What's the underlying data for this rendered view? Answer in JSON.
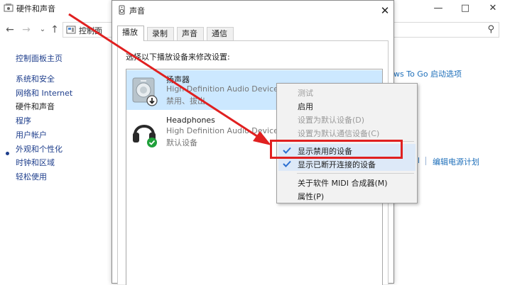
{
  "control_panel": {
    "title": "硬件和声音",
    "address_text": "控制面",
    "sidebar": [
      {
        "label": "控制面板主页",
        "active": false
      },
      {
        "label": "系统和安全",
        "active": false
      },
      {
        "label": "网络和 Internet",
        "active": false
      },
      {
        "label": "硬件和声音",
        "active": true
      },
      {
        "label": "程序",
        "active": false
      },
      {
        "label": "用户帐户",
        "active": false
      },
      {
        "label": "外观和个性化",
        "active": false
      },
      {
        "label": "时钟和区域",
        "active": false
      },
      {
        "label": "轻松使用",
        "active": false
      }
    ],
    "links": {
      "windows_to_go": "ws To Go 启动选项",
      "edit_power": "编辑电源计划",
      "frag": "l"
    }
  },
  "sound_dialog": {
    "title": "声音",
    "tabs": [
      {
        "label": "播放",
        "selected": true
      },
      {
        "label": "录制",
        "selected": false
      },
      {
        "label": "声音",
        "selected": false
      },
      {
        "label": "通信",
        "selected": false
      }
    ],
    "instruction": "选择以下播放设备来修改设置:",
    "devices": [
      {
        "name": "扬声器",
        "description": "High Definition Audio Device",
        "status": "禁用、拔出",
        "selected": true,
        "badge": "down-arrow-badge"
      },
      {
        "name": "Headphones",
        "description": "High Definition Audio Device",
        "status": "默认设备",
        "selected": false,
        "badge": "green-check-badge"
      }
    ]
  },
  "context_menu": {
    "items": [
      {
        "label": "测试",
        "disabled": true,
        "checked": false
      },
      {
        "label": "启用",
        "disabled": false,
        "checked": false
      },
      {
        "label": "设置为默认设备(D)",
        "disabled": true,
        "checked": false
      },
      {
        "label": "设置为默认通信设备(C)",
        "disabled": true,
        "checked": false
      },
      {
        "label": "显示禁用的设备",
        "disabled": false,
        "checked": true
      },
      {
        "label": "显示已断开连接的设备",
        "disabled": false,
        "checked": true
      },
      {
        "label": "关于软件 MIDI 合成器(M)",
        "disabled": false,
        "checked": false
      },
      {
        "label": "属性(P)",
        "disabled": false,
        "checked": false
      }
    ]
  },
  "colors": {
    "annotation_red": "#e02020",
    "selection_blue": "#cce8ff",
    "link_blue": "#1e6fba",
    "check_blue": "#2b6fd1",
    "badge_green": "#1fa03a"
  }
}
